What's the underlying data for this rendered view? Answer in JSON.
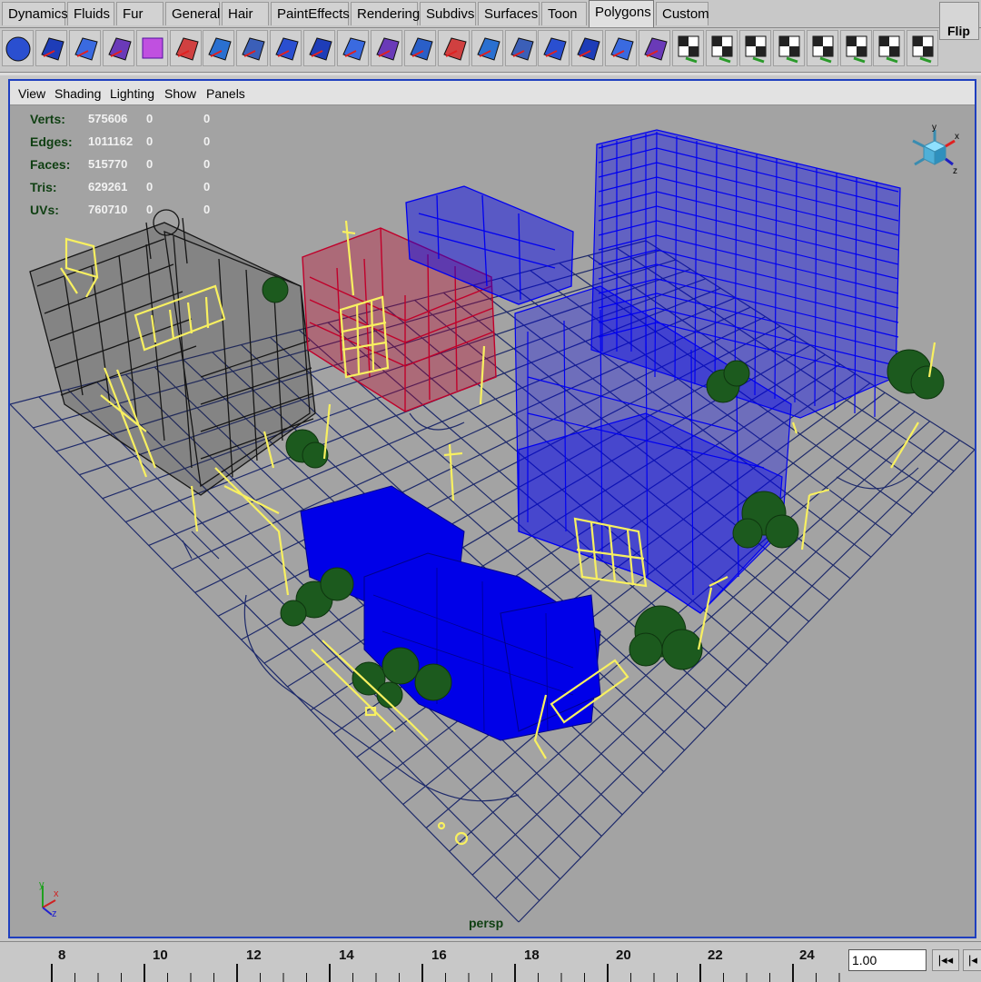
{
  "shelf_tabs": [
    "Dynamics",
    "Fluids",
    "Fur",
    "General",
    "Hair",
    "PaintEffects",
    "Rendering",
    "Subdivs",
    "Surfaces",
    "Toon",
    "Polygons",
    "Custom"
  ],
  "active_tab": "Polygons",
  "shelf_icons": [
    "polygon-sphere-icon",
    "polygon-cube-icon",
    "polygon-cylinder-icon",
    "polygon-cone-icon",
    "polygon-plane-icon",
    "combine-icon",
    "separate-icon",
    "extract-icon",
    "smooth-icon",
    "bridge-icon",
    "split-polygon-icon",
    "extrude-face-icon",
    "extrude-edge-icon",
    "wedge-face-icon",
    "bevel-icon",
    "merge-vertices-icon",
    "cut-faces-icon",
    "append-polygon-icon",
    "poke-face-icon",
    "duplicate-face-icon",
    "planar-mapping-icon",
    "uv-texture-editor-icon",
    "automatic-mapping-icon",
    "sew-uv-icon",
    "unfold-uv-icon",
    "layout-uv-icon",
    "checker-icon",
    "flip-uv-icon"
  ],
  "flip_label": "Flip",
  "viewport_menu": [
    "View",
    "Shading",
    "Lighting",
    "Show",
    "Panels"
  ],
  "stats": [
    {
      "label": "Verts:",
      "v1": "575606",
      "v2": "0",
      "v3": "0"
    },
    {
      "label": "Edges:",
      "v1": "1011162",
      "v2": "0",
      "v3": "0"
    },
    {
      "label": "Faces:",
      "v1": "515770",
      "v2": "0",
      "v3": "0"
    },
    {
      "label": "Tris:",
      "v1": "629261",
      "v2": "0",
      "v3": "0"
    },
    {
      "label": "UVs:",
      "v1": "760710",
      "v2": "0",
      "v3": "0"
    }
  ],
  "camera_label": "persp",
  "axis_labels": {
    "x": "x",
    "y": "y",
    "z": "z"
  },
  "timeline": {
    "ticks": [
      "8",
      "10",
      "12",
      "14",
      "16",
      "18",
      "20",
      "22",
      "24"
    ],
    "current_frame": "1.00",
    "rewind_label": "|◂◂",
    "step_back_label": "|◂"
  },
  "colors": {
    "viewport_bg": "#a3a3a3",
    "wire_blue": "#0000f0",
    "wire_black": "#151515",
    "wire_red": "#c0002a",
    "wire_yellow": "#f8f060",
    "tree_green": "#1c5a1e",
    "grid": "#1e2a6a"
  }
}
